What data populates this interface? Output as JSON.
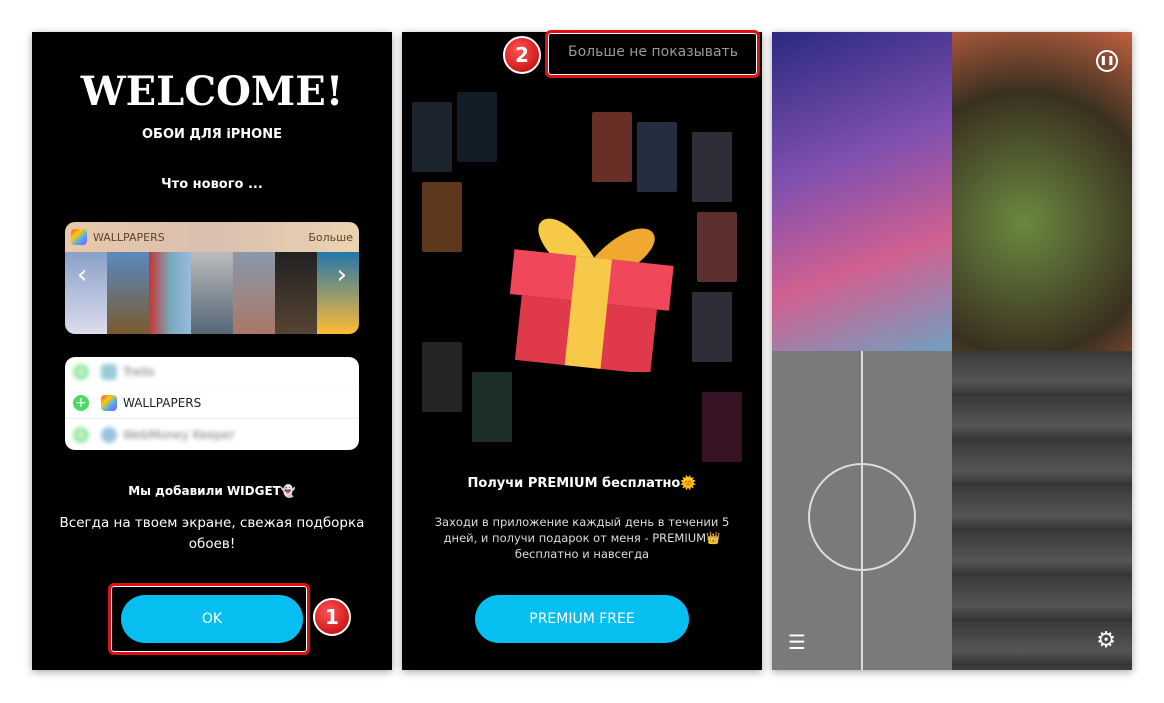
{
  "screen1": {
    "title": "WELCOME!",
    "subtitle": "ОБОИ ДЛЯ iPHONE",
    "whats_new": "Что нового ...",
    "widget": {
      "app_name": "WALLPAPERS",
      "more": "Больше"
    },
    "widget_list": [
      {
        "label": "Trello"
      },
      {
        "label": "WALLPAPERS"
      },
      {
        "label": "WebMoney Keeper"
      }
    ],
    "added": "Мы добавили WIDGET👻",
    "description": "Всегда на твоем экране, свежая подборка обоев!",
    "ok_label": "OK",
    "step_badge": "1"
  },
  "screen2": {
    "dont_show_label": "Больше не показывать",
    "step_badge": "2",
    "title": "Получи PREMIUM бесплатно🌞",
    "description": "Заходи в приложение каждый день в течении 5 дней, и получи подарок от меня - PREMIUM👑 бесплатно и навсегда",
    "button_label": "PREMIUM FREE"
  },
  "screen3": {
    "icons": [
      "pause-icon",
      "menu-icon",
      "gear-icon"
    ]
  },
  "colors": {
    "accent": "#06bff0",
    "highlight": "#dd1111",
    "background": "#000000"
  }
}
